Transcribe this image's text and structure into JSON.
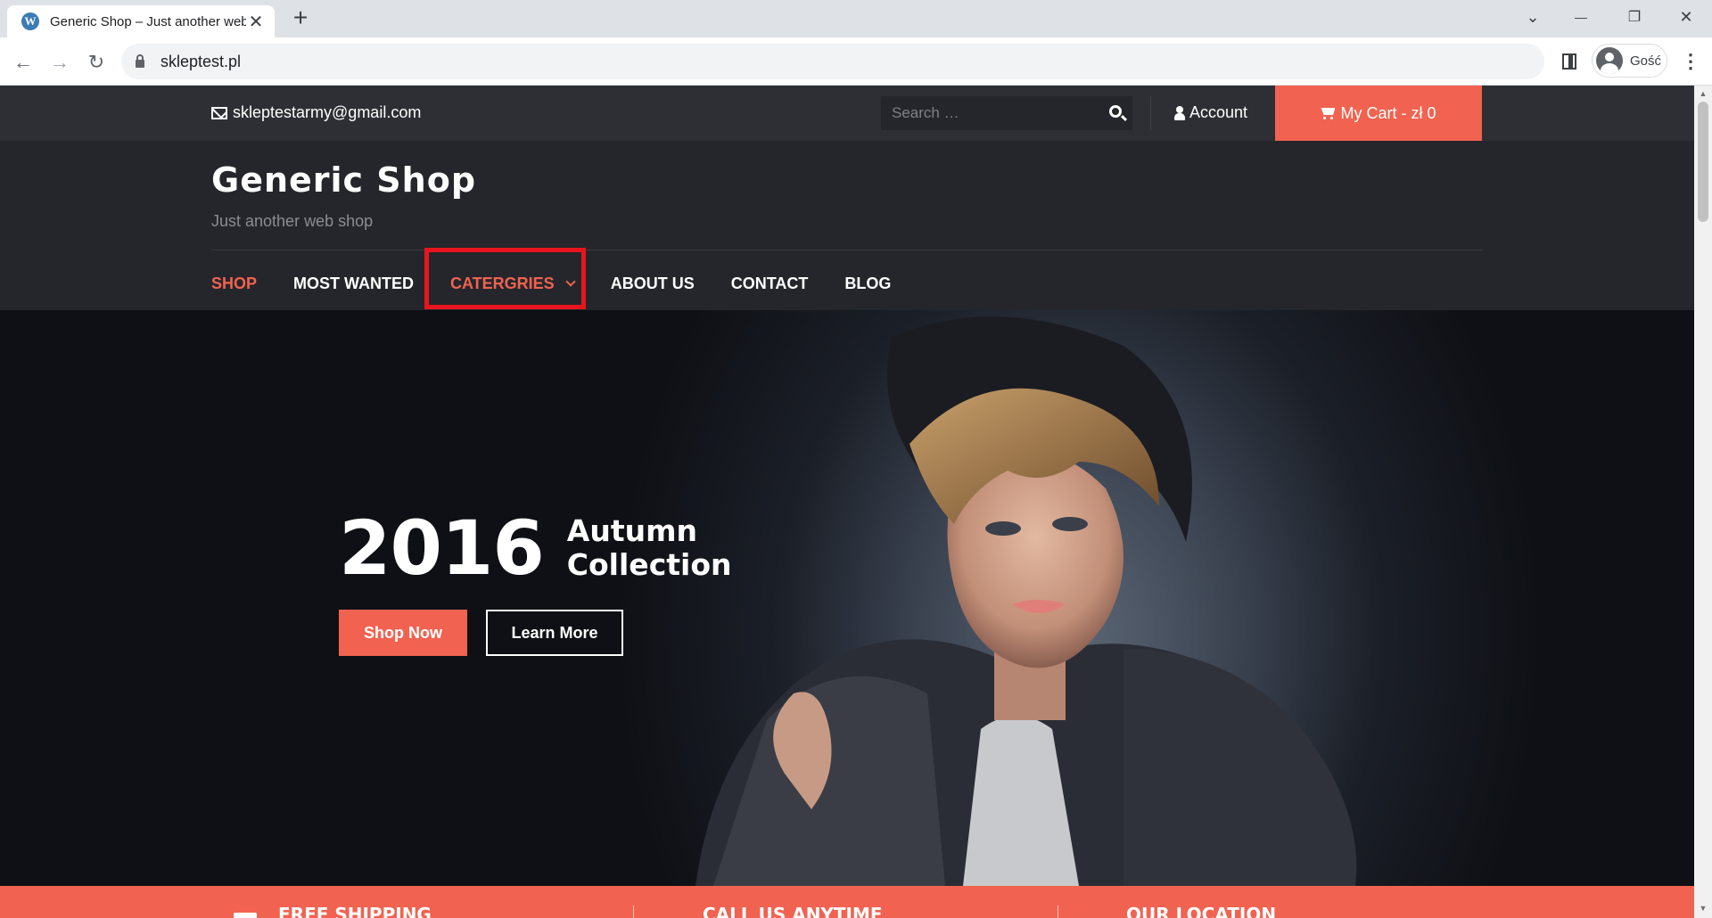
{
  "browser": {
    "tab_title": "Generic Shop – Just another web shop",
    "tab_favicon": "W",
    "new_tab": "+",
    "close_tab": "✕",
    "url": "skleptest.pl",
    "profile_label": "Gość",
    "back": "←",
    "forward": "→",
    "reload": "↻",
    "menu": "⋮",
    "tab_search": "⌄",
    "minimize": "—",
    "restore": "❐",
    "close_window": "✕"
  },
  "topbar": {
    "email": "skleptestarmy@gmail.com",
    "search_placeholder": "Search …",
    "account": "Account",
    "cart": "My Cart - zł 0"
  },
  "header": {
    "site_title": "Generic Shop",
    "tagline": "Just another web shop"
  },
  "nav": {
    "items": [
      {
        "label": "SHOP"
      },
      {
        "label": "MOST WANTED"
      },
      {
        "label": "CATERGRIES"
      },
      {
        "label": "ABOUT US"
      },
      {
        "label": "CONTACT"
      },
      {
        "label": "BLOG"
      }
    ]
  },
  "hero": {
    "year": "2016",
    "line1": "Autumn",
    "line2": "Collection",
    "shop_now": "Shop Now",
    "learn_more": "Learn More"
  },
  "features": [
    {
      "label": "FREE SHIPPING"
    },
    {
      "label": "CALL US ANYTIME"
    },
    {
      "label": "OUR LOCATION"
    }
  ],
  "colors": {
    "accent": "#f16350",
    "highlight": "#e8151e",
    "dark": "#24262b"
  }
}
